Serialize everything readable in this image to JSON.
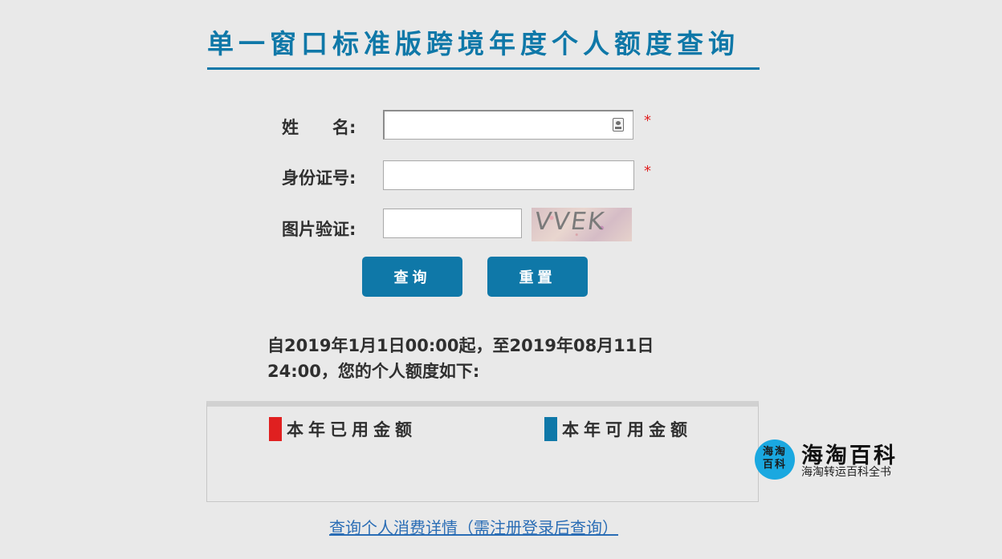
{
  "header": {
    "title": "单一窗口标准版跨境年度个人额度查询"
  },
  "form": {
    "name_label_part1": "姓",
    "name_label_part2": "名:",
    "id_label": "身份证号:",
    "captcha_label": "图片验证:",
    "required_mark": "*",
    "name_value": "",
    "id_value": "",
    "captcha_value": "",
    "captcha_image_text": "VVEK"
  },
  "buttons": {
    "query_label": "查询",
    "reset_label": "重置"
  },
  "notice": {
    "text": "自2019年1月1日00:00起，至2019年08月11日 24:00，您的个人额度如下:"
  },
  "quota": {
    "used_label": "本年已用金额",
    "available_label": "本年可用金额",
    "used_color": "#e02020",
    "available_color": "#0f78a8"
  },
  "links": {
    "detail_label": "查询个人消费详情（需注册登录后查询）"
  },
  "watermark": {
    "logo_text_line1": "海淘",
    "logo_text_line2": "百科",
    "title": "海淘百科",
    "subtitle": "海淘转运百科全书"
  },
  "colors": {
    "accent": "#0f78a8",
    "background": "#e9e9e9",
    "required": "#e02020",
    "link": "#2a6db5"
  }
}
